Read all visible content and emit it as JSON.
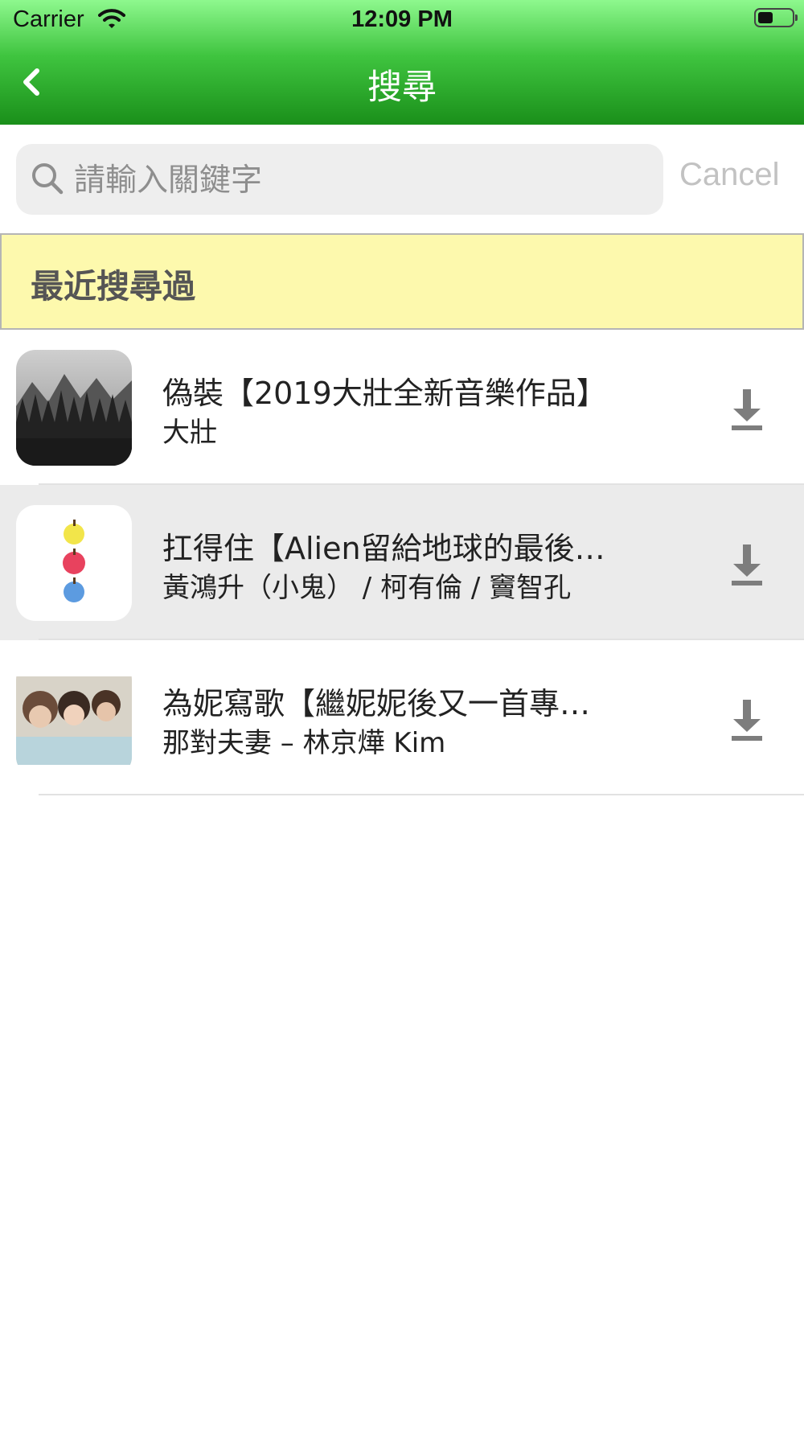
{
  "status_bar": {
    "carrier": "Carrier",
    "time": "12:09 PM",
    "battery_level": 0.45
  },
  "nav": {
    "title": "搜尋",
    "back_icon": "chevron-left-icon"
  },
  "search": {
    "placeholder": "請輸入關鍵字",
    "value": "",
    "cancel_label": "Cancel",
    "icon": "search-icon"
  },
  "recent": {
    "title": "最近搜尋過"
  },
  "results": [
    {
      "title": "偽裝【2019大壯全新音樂作品】",
      "artist": "大壯",
      "thumb": "forest-album-art",
      "action_icon": "download-icon"
    },
    {
      "title": "扛得住【Alien留給地球的最後…",
      "artist": "黃鴻升（小鬼） / 柯有倫 / 竇智孔",
      "thumb": "apples-album-art",
      "action_icon": "download-icon"
    },
    {
      "title": "為妮寫歌【繼妮妮後又一首專…",
      "artist": "那對夫妻 – 林京燁 Kim",
      "thumb": "family-photo-album-art",
      "action_icon": "download-icon"
    }
  ],
  "colors": {
    "header_top": "#8ef88e",
    "header_bottom": "#1a8f1a",
    "recent_bg": "#fdf9ad",
    "selected_row": "#ebebeb"
  }
}
